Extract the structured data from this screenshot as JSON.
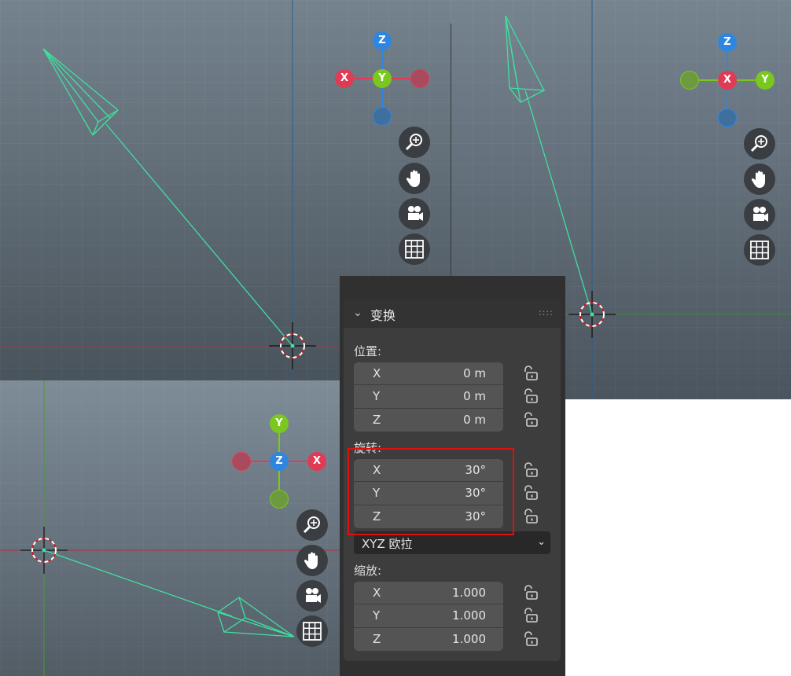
{
  "panel": {
    "title": "变换",
    "grip": "::::",
    "location": {
      "label": "位置:",
      "rows": [
        {
          "axis": "X",
          "value": "0 m"
        },
        {
          "axis": "Y",
          "value": "0 m"
        },
        {
          "axis": "Z",
          "value": "0 m"
        }
      ]
    },
    "rotation": {
      "label": "旋转:",
      "rows": [
        {
          "axis": "X",
          "value": "30°"
        },
        {
          "axis": "Y",
          "value": "30°"
        },
        {
          "axis": "Z",
          "value": "30°"
        }
      ],
      "mode": "XYZ 欧拉"
    },
    "scale": {
      "label": "缩放:",
      "rows": [
        {
          "axis": "X",
          "value": "1.000"
        },
        {
          "axis": "Y",
          "value": "1.000"
        },
        {
          "axis": "Z",
          "value": "1.000"
        }
      ]
    }
  },
  "gizmo_labels": {
    "x": "X",
    "y": "Y",
    "z": "Z"
  },
  "colors": {
    "axis_x": "#e03b55",
    "axis_y": "#7ac81e",
    "axis_z": "#2f86e0",
    "camera_wire": "#3fe0a0",
    "panel_bg": "#3d3d3d",
    "highlight": "#e01010"
  },
  "nav_icons": [
    "zoom-icon",
    "hand-pan-icon",
    "camera-icon",
    "grid-icon"
  ]
}
